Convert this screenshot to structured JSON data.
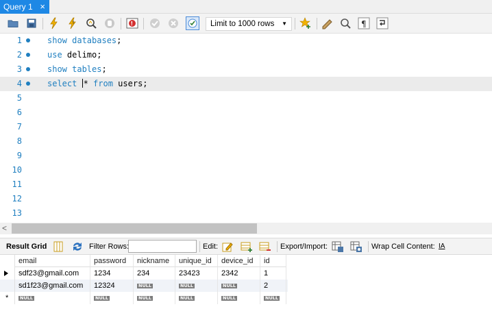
{
  "tab": {
    "title": "Query 1",
    "close": "×"
  },
  "toolbar": {
    "limit_value": "Limit to 1000 rows",
    "icons": [
      "open-folder-icon",
      "save-icon",
      "execute-icon",
      "execute-current-icon",
      "explain-icon",
      "stop-icon",
      "toggle-error-icon",
      "commit-icon",
      "rollback-icon",
      "autocommit-icon",
      "limit-dropdown",
      "bookmark-icon",
      "beautify-icon",
      "find-icon",
      "invisible-chars-icon",
      "wrap-icon"
    ]
  },
  "editor": {
    "lines": [
      {
        "num": "1",
        "code": [
          {
            "t": "show databases",
            "kw": true
          },
          {
            "t": ";",
            "kw": false
          }
        ]
      },
      {
        "num": "2",
        "code": [
          {
            "t": "use",
            "kw": true
          },
          {
            "t": " delimo;",
            "kw": false
          }
        ]
      },
      {
        "num": "3",
        "code": [
          {
            "t": "show tables",
            "kw": true
          },
          {
            "t": ";",
            "kw": false
          }
        ]
      },
      {
        "num": "4",
        "code": [
          {
            "t": "select",
            "kw": true
          },
          {
            "t": " ",
            "kw": false
          },
          {
            "t": "CARET",
            "kw": false
          },
          {
            "t": "* ",
            "kw": false
          },
          {
            "t": "from",
            "kw": true
          },
          {
            "t": " users;",
            "kw": false
          }
        ]
      },
      {
        "num": "5",
        "code": []
      },
      {
        "num": "6",
        "code": []
      },
      {
        "num": "7",
        "code": []
      },
      {
        "num": "8",
        "code": []
      },
      {
        "num": "9",
        "code": []
      },
      {
        "num": "10",
        "code": []
      },
      {
        "num": "11",
        "code": []
      },
      {
        "num": "12",
        "code": []
      },
      {
        "num": "13",
        "code": []
      }
    ],
    "current_line": 4
  },
  "result_toolbar": {
    "result_grid": "Result Grid",
    "filter_rows": "Filter Rows:",
    "filter_value": "",
    "edit": "Edit:",
    "export_import": "Export/Import:",
    "wrap_cell": "Wrap Cell Content:",
    "wrap_icon_text": "IA"
  },
  "grid": {
    "columns": [
      "email",
      "password",
      "nickname",
      "unique_id",
      "device_id",
      "id"
    ],
    "rows": [
      [
        "sdf23@gmail.com",
        "1234",
        "234",
        "23423",
        "2342",
        "1"
      ],
      [
        "sd1f23@gmail.com",
        "12324",
        "NULL",
        "NULL",
        "NULL",
        "2"
      ],
      [
        "NULL",
        "NULL",
        "NULL",
        "NULL",
        "NULL",
        "NULL"
      ]
    ],
    "null_label": "NULL",
    "new_row_marker": "*"
  },
  "colors": {
    "tab": "#1e88e5",
    "keyword": "#1f7fc0",
    "current_line": "#ebebeb"
  }
}
